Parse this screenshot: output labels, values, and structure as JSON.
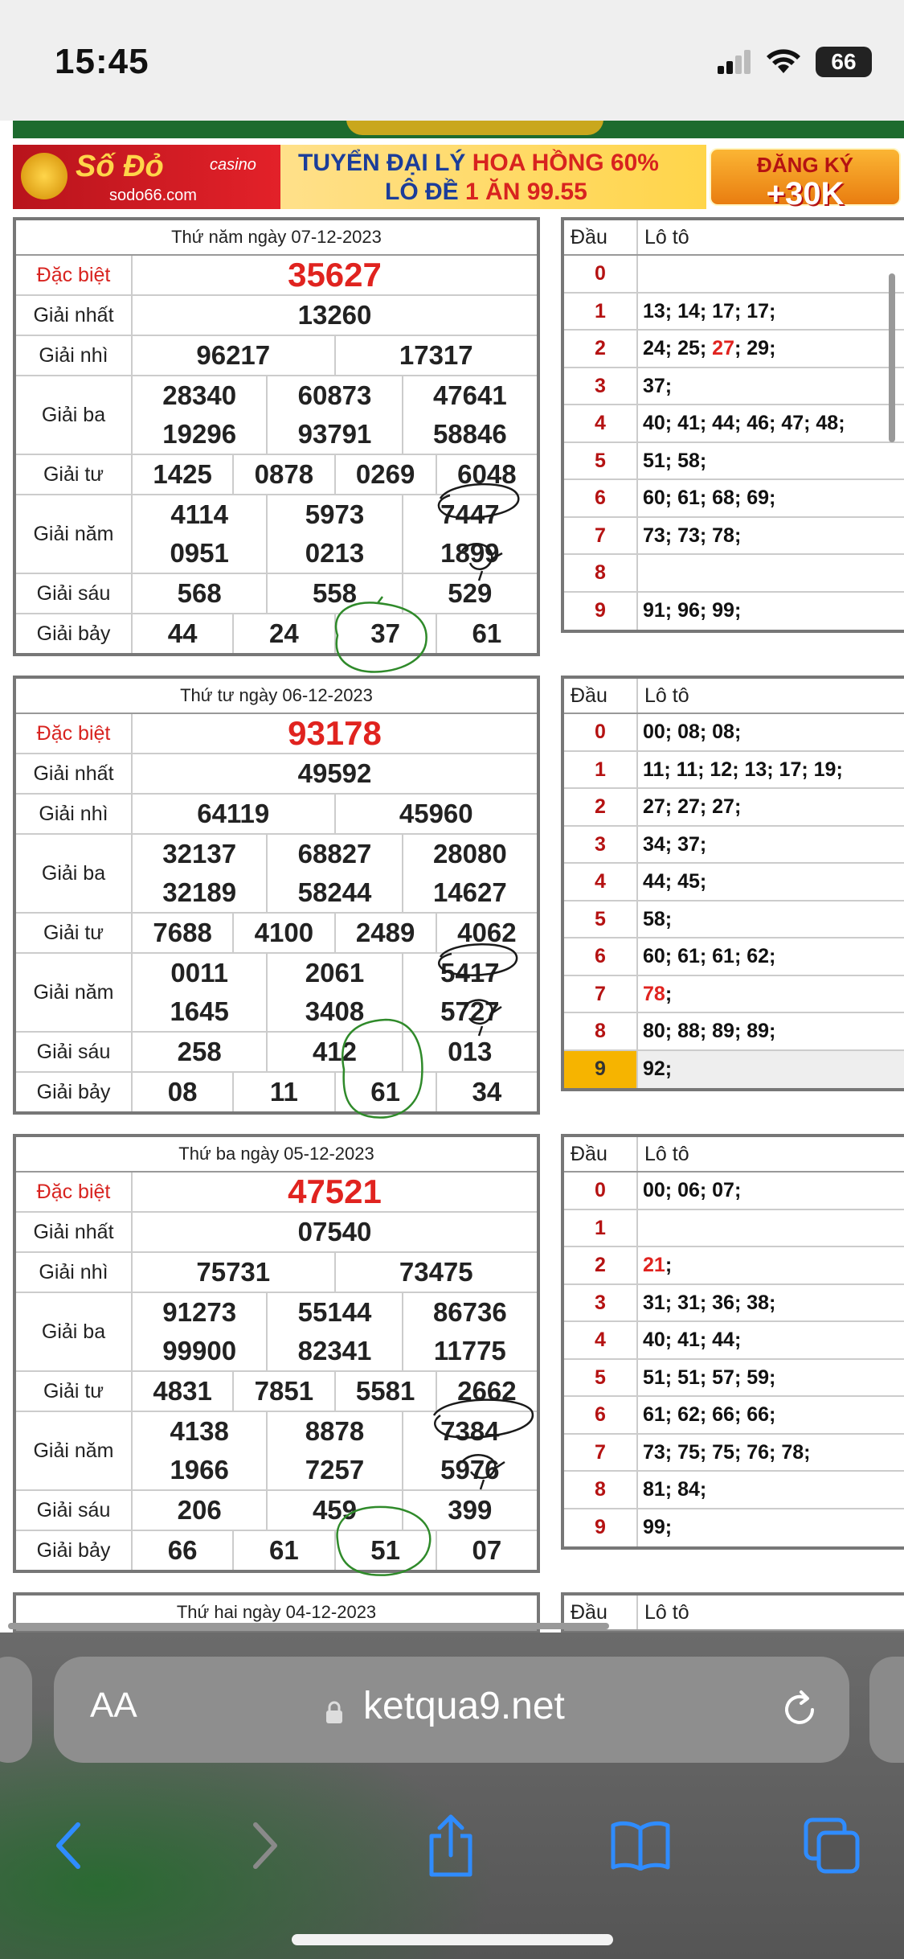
{
  "status": {
    "time": "15:45",
    "battery": "66"
  },
  "banner": {
    "brand": "Số Đỏ",
    "brand_tag": "casino",
    "site": "sodo66.com",
    "line1_a": "TUYỂN ĐẠI LÝ ",
    "line1_b": "HOA HỒNG 60%",
    "line2_a": "LÔ ĐỀ ",
    "line2_b": "1 ĂN 99.55",
    "cta_top": "ĐĂNG KÝ",
    "cta_bottom": "+30K"
  },
  "labels": {
    "special": "Đặc biệt",
    "first": "Giải nhất",
    "second": "Giải nhì",
    "third": "Giải ba",
    "fourth": "Giải tư",
    "fifth": "Giải năm",
    "sixth": "Giải sáu",
    "seventh": "Giải bảy",
    "dau": "Đầu",
    "loto": "Lô tô"
  },
  "draws": [
    {
      "date": "Thứ năm ngày 07-12-2023",
      "special": "35627",
      "first": "13260",
      "second": [
        "96217",
        "17317"
      ],
      "third": [
        "28340",
        "60873",
        "47641",
        "19296",
        "93791",
        "58846"
      ],
      "fourth": [
        "1425",
        "0878",
        "0269",
        "6048"
      ],
      "fifth": [
        "4114",
        "5973",
        "7447",
        "0951",
        "0213",
        "1899"
      ],
      "sixth": [
        "568",
        "558",
        "529"
      ],
      "seventh": [
        "44",
        "24",
        "37",
        "61"
      ],
      "loto": [
        {
          "d": "0",
          "v": ""
        },
        {
          "d": "1",
          "v": "13; 14; 17; 17;"
        },
        {
          "d": "2",
          "a": "24; 25; ",
          "r": "27",
          "b": "; 29;"
        },
        {
          "d": "3",
          "v": "37;"
        },
        {
          "d": "4",
          "v": "40; 41; 44; 46; 47; 48;"
        },
        {
          "d": "5",
          "v": "51; 58;"
        },
        {
          "d": "6",
          "v": "60; 61; 68; 69;"
        },
        {
          "d": "7",
          "v": "73; 73; 78;"
        },
        {
          "d": "8",
          "v": ""
        },
        {
          "d": "9",
          "v": "91; 96; 99;"
        }
      ]
    },
    {
      "date": "Thứ tư ngày 06-12-2023",
      "special": "93178",
      "first": "49592",
      "second": [
        "64119",
        "45960"
      ],
      "third": [
        "32137",
        "68827",
        "28080",
        "32189",
        "58244",
        "14627"
      ],
      "fourth": [
        "7688",
        "4100",
        "2489",
        "4062"
      ],
      "fifth": [
        "0011",
        "2061",
        "5417",
        "1645",
        "3408",
        "5727"
      ],
      "sixth": [
        "258",
        "412",
        "013"
      ],
      "seventh": [
        "08",
        "11",
        "61",
        "34"
      ],
      "loto": [
        {
          "d": "0",
          "v": "00; 08; 08;"
        },
        {
          "d": "1",
          "v": "11; 11; 12; 13; 17; 19;"
        },
        {
          "d": "2",
          "v": "27; 27; 27;"
        },
        {
          "d": "3",
          "v": "34; 37;"
        },
        {
          "d": "4",
          "v": "44; 45;"
        },
        {
          "d": "5",
          "v": "58;"
        },
        {
          "d": "6",
          "v": "60; 61; 61; 62;"
        },
        {
          "d": "7",
          "a": "",
          "r": "78",
          "b": ";"
        },
        {
          "d": "8",
          "v": "80; 88; 89; 89;"
        },
        {
          "d": "9",
          "v": "92;"
        }
      ]
    },
    {
      "date": "Thứ ba ngày 05-12-2023",
      "special": "47521",
      "first": "07540",
      "second": [
        "75731",
        "73475"
      ],
      "third": [
        "91273",
        "55144",
        "86736",
        "99900",
        "82341",
        "11775"
      ],
      "fourth": [
        "4831",
        "7851",
        "5581",
        "2662"
      ],
      "fifth": [
        "4138",
        "8878",
        "7384",
        "1966",
        "7257",
        "5976"
      ],
      "sixth": [
        "206",
        "459",
        "399"
      ],
      "seventh": [
        "66",
        "61",
        "51",
        "07"
      ],
      "loto": [
        {
          "d": "0",
          "v": "00; 06; 07;"
        },
        {
          "d": "1",
          "v": ""
        },
        {
          "d": "2",
          "a": "",
          "r": "21",
          "b": ";"
        },
        {
          "d": "3",
          "v": "31; 31; 36; 38;"
        },
        {
          "d": "4",
          "v": "40; 41; 44;"
        },
        {
          "d": "5",
          "v": "51; 51; 57; 59;"
        },
        {
          "d": "6",
          "v": "61; 62; 66; 66;"
        },
        {
          "d": "7",
          "v": "73; 75; 75; 76; 78;"
        },
        {
          "d": "8",
          "v": "81; 84;"
        },
        {
          "d": "9",
          "v": "99;"
        }
      ]
    },
    {
      "date": "Thứ hai ngày 04-12-2023"
    }
  ],
  "browser": {
    "aa_label": "AA",
    "url": "ketqua9.net"
  }
}
